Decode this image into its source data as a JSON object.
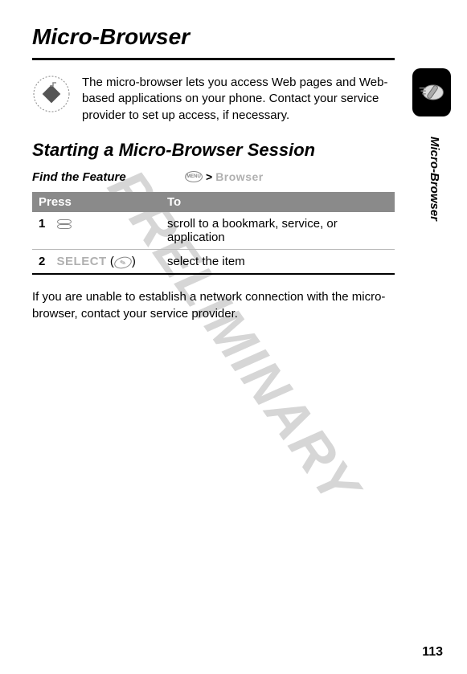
{
  "watermark": "PRELIMINARY",
  "page_title": "Micro-Browser",
  "intro_text": "The micro-browser lets you access Web pages and Web-based applications on your phone. Contact your service provider to set up access, if necessary.",
  "section_heading": "Starting a Micro-Browser Session",
  "feature": {
    "label": "Find the Feature",
    "menu_label": "MENU",
    "separator": ">",
    "target": "Browser"
  },
  "table": {
    "headers": [
      "Press",
      "To"
    ],
    "rows": [
      {
        "num": "1",
        "press_icon": "scroll",
        "press_text": "",
        "to": "scroll to a bookmark, service, or application"
      },
      {
        "num": "2",
        "press_icon": "select",
        "press_text": "SELECT",
        "to": "select the item"
      }
    ]
  },
  "note": "If you are unable to establish a network connection with the micro-browser, contact your service provider.",
  "side_label": "Micro-Browser",
  "page_number": "113"
}
